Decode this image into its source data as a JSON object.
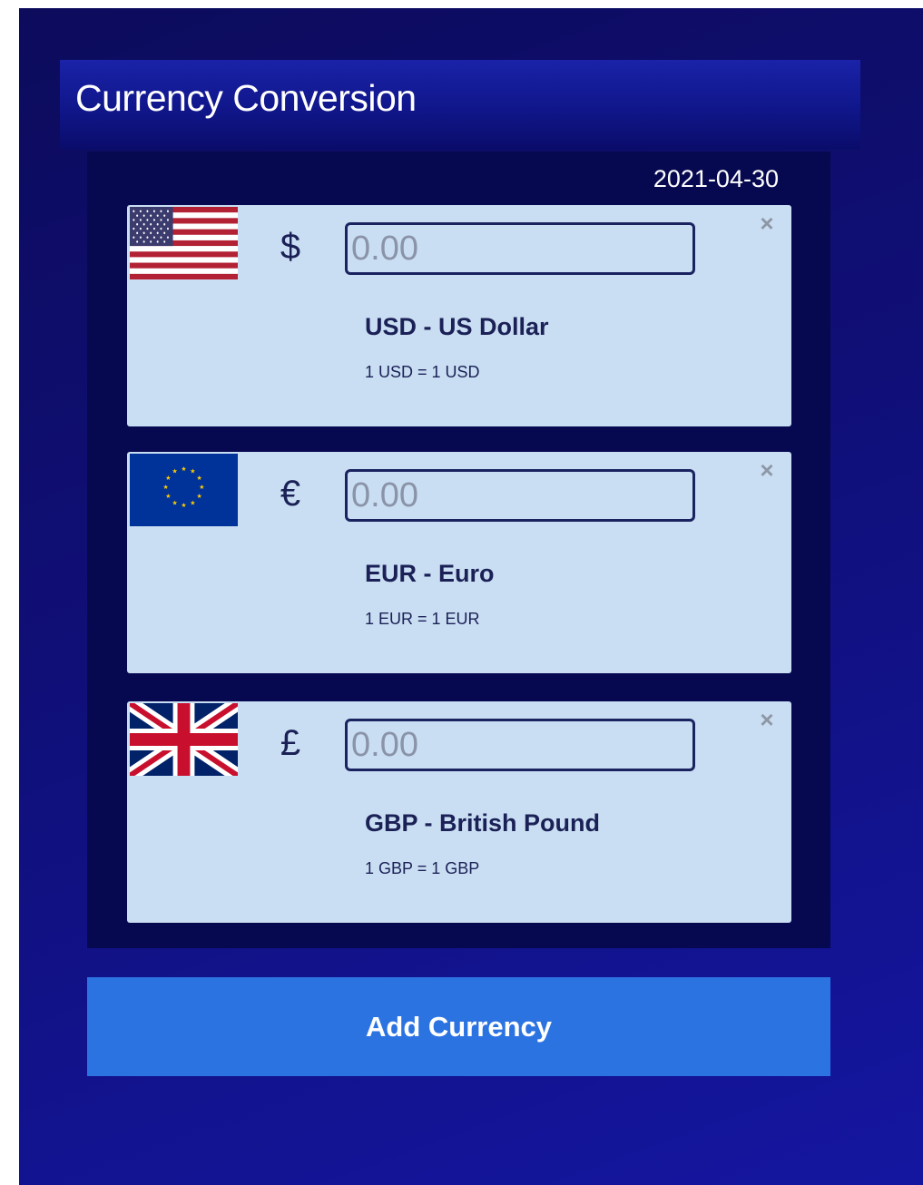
{
  "header": {
    "title": "Currency Conversion"
  },
  "date": "2021-04-30",
  "currencies": [
    {
      "flag_icon": "us-flag-icon",
      "symbol": "$",
      "amount_value": "",
      "amount_placeholder": "0.00",
      "name": "USD - US Dollar",
      "rate": "1 USD = 1 USD",
      "close_label": "×"
    },
    {
      "flag_icon": "eu-flag-icon",
      "symbol": "€",
      "amount_value": "",
      "amount_placeholder": "0.00",
      "name": "EUR - Euro",
      "rate": "1 EUR = 1 EUR",
      "close_label": "×"
    },
    {
      "flag_icon": "uk-flag-icon",
      "symbol": "£",
      "amount_value": "",
      "amount_placeholder": "0.00",
      "name": "GBP - British Pound",
      "rate": "1 GBP = 1 GBP",
      "close_label": "×"
    }
  ],
  "add_button": {
    "label": "Add Currency"
  },
  "colors": {
    "background": "#100f78",
    "panel": "#070950",
    "card": "#c9def2",
    "text_dark": "#1b2156",
    "button": "#2c73e2"
  }
}
